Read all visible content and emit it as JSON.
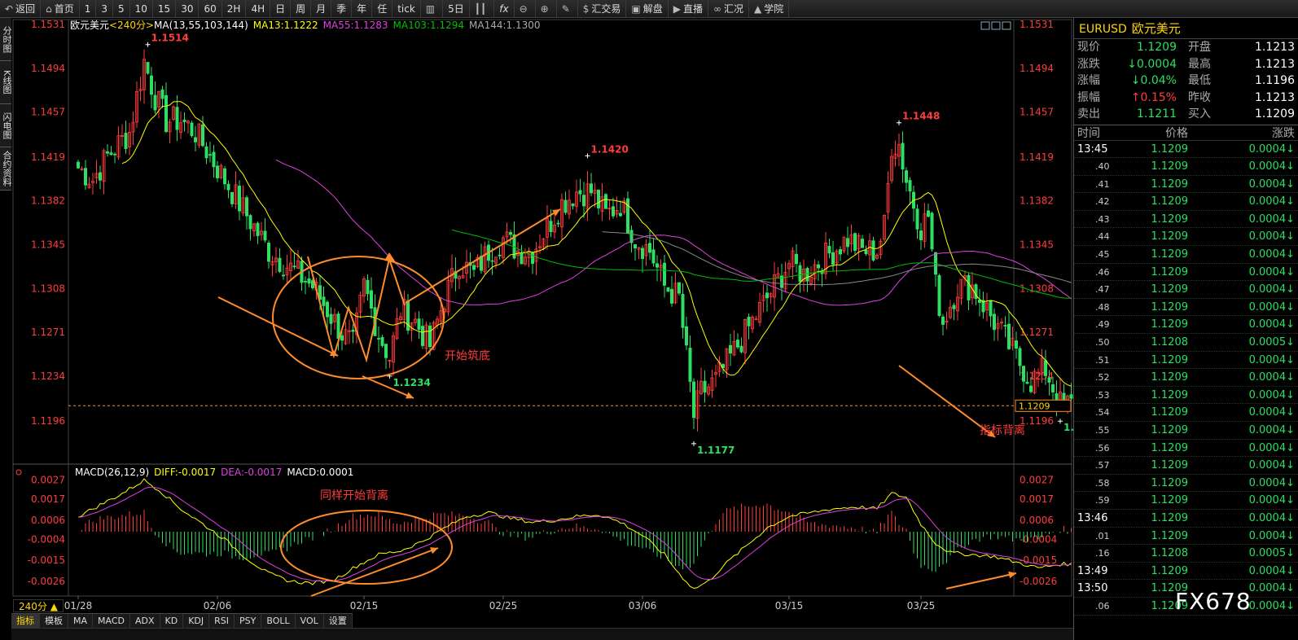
{
  "toolbar": {
    "items": [
      {
        "icon": "back-arrow-icon",
        "label": "返回"
      },
      {
        "icon": "home-icon",
        "label": "首页"
      },
      {
        "label": "1"
      },
      {
        "label": "3"
      },
      {
        "label": "5"
      },
      {
        "label": "10"
      },
      {
        "label": "15"
      },
      {
        "label": "30"
      },
      {
        "label": "60"
      },
      {
        "label": "2H"
      },
      {
        "label": "4H"
      },
      {
        "label": "日"
      },
      {
        "label": "周"
      },
      {
        "label": "月"
      },
      {
        "label": "季"
      },
      {
        "label": "年"
      },
      {
        "label": "任"
      },
      {
        "label": "tick"
      },
      {
        "icon": "draw-icon",
        "label": ""
      },
      {
        "label": "5日"
      },
      {
        "icon": "candle-icon",
        "label": ""
      },
      {
        "icon": "fx-icon",
        "label": "fx"
      },
      {
        "icon": "zoom-out-icon",
        "label": ""
      },
      {
        "icon": "zoom-in-icon",
        "label": ""
      },
      {
        "icon": "pen-icon",
        "label": ""
      },
      {
        "icon": "dollar-icon",
        "label": "汇交易"
      },
      {
        "icon": "chat-icon",
        "label": "解盘"
      },
      {
        "icon": "live-icon",
        "label": "直播"
      },
      {
        "icon": "link-icon",
        "label": "汇况"
      },
      {
        "icon": "school-icon",
        "label": "学院"
      }
    ]
  },
  "sidetabs": [
    "分时图",
    "K线图",
    "闪电图",
    "合约资料"
  ],
  "header": {
    "symbol": "欧元美元",
    "period": "<240分>",
    "ma": "MA(13,55,103,144)",
    "ma13": "MA13:1.1222",
    "ma55": "MA55:1.1283",
    "ma103": "MA103:1.1294",
    "ma144": "MA144:1.1300"
  },
  "macd_header": {
    "name": "MACD(26,12,9)",
    "diff": "DIFF:-0.0017",
    "dea": "DEA:-0.0017",
    "macd": "MACD:0.0001"
  },
  "period_button": "240分 ▲",
  "indicator_tabs": [
    "指标",
    "模板",
    "MA",
    "MACD",
    "ADX",
    "KD",
    "KDJ",
    "RSI",
    "PSY",
    "BOLL",
    "VOL",
    "设置"
  ],
  "watermark": "FX678",
  "colors": {
    "up": "#ff3c3c",
    "down": "#2ddf62",
    "ma13": "#ffff00",
    "ma55": "#e040e0",
    "ma103": "#00c000",
    "ma144": "#888888",
    "annotation": "#ff8c2a",
    "diff": "#ffff00",
    "dea": "#e040e0"
  },
  "chart_data": {
    "type": "candlestick",
    "price_axis": {
      "min": 1.117,
      "max": 1.1531,
      "ticks": [
        "1.1531",
        "1.1494",
        "1.1457",
        "1.1419",
        "1.1382",
        "1.1345",
        "1.1308",
        "1.1271",
        "1.1234",
        "1.1196"
      ]
    },
    "macd_axis": {
      "min": -0.0032,
      "max": 0.0029,
      "ticks": [
        "0.0027",
        "0.0017",
        "0.0006",
        "-0.0004",
        "-0.0015",
        "-0.0026"
      ]
    },
    "x_labels": [
      {
        "label": "01/28",
        "i": 0
      },
      {
        "label": "02/06",
        "i": 38
      },
      {
        "label": "02/15",
        "i": 78
      },
      {
        "label": "02/25",
        "i": 116
      },
      {
        "label": "03/06",
        "i": 154
      },
      {
        "label": "03/15",
        "i": 194
      },
      {
        "label": "03/25",
        "i": 230
      }
    ],
    "current_price": "1.1209",
    "price_labels": [
      {
        "text": "1.1514",
        "i": 19,
        "v": 1.1514,
        "kind": "high"
      },
      {
        "text": "1.1420",
        "i": 139,
        "v": 1.142,
        "kind": "high"
      },
      {
        "text": "1.1448",
        "i": 224,
        "v": 1.1448,
        "kind": "high"
      },
      {
        "text": "1.1234",
        "i": 85,
        "v": 1.1234,
        "kind": "low"
      },
      {
        "text": "1.1177",
        "i": 168,
        "v": 1.1177,
        "kind": "low"
      },
      {
        "text": "1.1196",
        "i": 268,
        "v": 1.1196,
        "kind": "low"
      }
    ],
    "anchors": [
      [
        0,
        1.141
      ],
      [
        4,
        1.14
      ],
      [
        8,
        1.142
      ],
      [
        14,
        1.144
      ],
      [
        18,
        1.15
      ],
      [
        21,
        1.147
      ],
      [
        24,
        1.145
      ],
      [
        28,
        1.145
      ],
      [
        32,
        1.144
      ],
      [
        36,
        1.142
      ],
      [
        40,
        1.14
      ],
      [
        44,
        1.138
      ],
      [
        48,
        1.136
      ],
      [
        52,
        1.134
      ],
      [
        56,
        1.133
      ],
      [
        60,
        1.132
      ],
      [
        64,
        1.131
      ],
      [
        68,
        1.129
      ],
      [
        72,
        1.127
      ],
      [
        75,
        1.126
      ],
      [
        78,
        1.131
      ],
      [
        82,
        1.127
      ],
      [
        85,
        1.125
      ],
      [
        88,
        1.129
      ],
      [
        92,
        1.128
      ],
      [
        96,
        1.126
      ],
      [
        100,
        1.13
      ],
      [
        104,
        1.133
      ],
      [
        108,
        1.132
      ],
      [
        112,
        1.134
      ],
      [
        116,
        1.135
      ],
      [
        120,
        1.134
      ],
      [
        124,
        1.134
      ],
      [
        128,
        1.136
      ],
      [
        132,
        1.138
      ],
      [
        136,
        1.139
      ],
      [
        140,
        1.139
      ],
      [
        144,
        1.137
      ],
      [
        148,
        1.138
      ],
      [
        152,
        1.135
      ],
      [
        156,
        1.134
      ],
      [
        160,
        1.131
      ],
      [
        164,
        1.13
      ],
      [
        166,
        1.125
      ],
      [
        168,
        1.12
      ],
      [
        170,
        1.122
      ],
      [
        174,
        1.123
      ],
      [
        178,
        1.125
      ],
      [
        182,
        1.127
      ],
      [
        186,
        1.129
      ],
      [
        190,
        1.131
      ],
      [
        194,
        1.133
      ],
      [
        198,
        1.132
      ],
      [
        202,
        1.133
      ],
      [
        206,
        1.134
      ],
      [
        210,
        1.135
      ],
      [
        214,
        1.134
      ],
      [
        218,
        1.134
      ],
      [
        220,
        1.136
      ],
      [
        222,
        1.143
      ],
      [
        224,
        1.143
      ],
      [
        226,
        1.14
      ],
      [
        230,
        1.136
      ],
      [
        232,
        1.137
      ],
      [
        234,
        1.131
      ],
      [
        236,
        1.128
      ],
      [
        240,
        1.131
      ],
      [
        244,
        1.131
      ],
      [
        248,
        1.129
      ],
      [
        252,
        1.127
      ],
      [
        256,
        1.125
      ],
      [
        260,
        1.123
      ],
      [
        264,
        1.124
      ],
      [
        268,
        1.121
      ],
      [
        271,
        1.121
      ]
    ],
    "macd_anchors": [
      [
        0,
        0.0008
      ],
      [
        6,
        0.0014
      ],
      [
        12,
        0.002
      ],
      [
        18,
        0.0027
      ],
      [
        22,
        0.0022
      ],
      [
        28,
        0.0012
      ],
      [
        34,
        0.0004
      ],
      [
        40,
        -0.0004
      ],
      [
        46,
        -0.0014
      ],
      [
        52,
        -0.0022
      ],
      [
        58,
        -0.0026
      ],
      [
        64,
        -0.0027
      ],
      [
        70,
        -0.0025
      ],
      [
        76,
        -0.0018
      ],
      [
        82,
        -0.0012
      ],
      [
        88,
        -0.001
      ],
      [
        94,
        -0.0005
      ],
      [
        100,
        0.0002
      ],
      [
        106,
        0.0008
      ],
      [
        112,
        0.001
      ],
      [
        118,
        0.0007
      ],
      [
        124,
        0.0005
      ],
      [
        130,
        0.0006
      ],
      [
        136,
        0.0008
      ],
      [
        142,
        0.0009
      ],
      [
        148,
        0.0005
      ],
      [
        154,
        -0.0002
      ],
      [
        160,
        -0.0012
      ],
      [
        164,
        -0.0022
      ],
      [
        168,
        -0.003
      ],
      [
        172,
        -0.0026
      ],
      [
        176,
        -0.0018
      ],
      [
        182,
        -0.0008
      ],
      [
        188,
        0.0002
      ],
      [
        194,
        0.0008
      ],
      [
        200,
        0.001
      ],
      [
        206,
        0.0012
      ],
      [
        212,
        0.0013
      ],
      [
        218,
        0.0012
      ],
      [
        222,
        0.002
      ],
      [
        226,
        0.0018
      ],
      [
        230,
        0.0004
      ],
      [
        234,
        -0.0006
      ],
      [
        238,
        -0.0011
      ],
      [
        244,
        -0.0012
      ],
      [
        250,
        -0.0013
      ],
      [
        256,
        -0.0016
      ],
      [
        262,
        -0.0019
      ],
      [
        268,
        -0.0017
      ],
      [
        271,
        -0.0017
      ]
    ],
    "annotations": [
      {
        "text": "开始筑底",
        "i": 100,
        "v": 1.1248
      },
      {
        "text": "指标背离",
        "i": 246,
        "v": 1.1185
      },
      {
        "text": "同样开始背离",
        "i": 66,
        "v": 0.0017,
        "pane": "macd"
      }
    ]
  },
  "quote": {
    "title_code": "EURUSD",
    "title_name": "欧元美元",
    "rows": [
      {
        "k": "现价",
        "v": "1.1209",
        "k2": "开盘",
        "v2": "1.1213",
        "vcls": "green"
      },
      {
        "k": "涨跌",
        "v": "↓0.0004",
        "k2": "最高",
        "v2": "1.1213",
        "vcls": "green"
      },
      {
        "k": "涨幅",
        "v": "↓0.04%",
        "k2": "最低",
        "v2": "1.1196",
        "vcls": "green"
      },
      {
        "k": "振幅",
        "v": "↑0.15%",
        "k2": "昨收",
        "v2": "1.1213",
        "vcls": "red"
      },
      {
        "k": "卖出",
        "v": "1.1211",
        "k2": "买入",
        "v2": "1.1209",
        "vcls": "green"
      }
    ],
    "tick_header": [
      "时间",
      "价格",
      "涨跌"
    ],
    "ticks": [
      {
        "t": "13:45",
        "p": "1.1209",
        "c": "0.0004↓",
        "big": true
      },
      {
        "t": ".40",
        "p": "1.1209",
        "c": "0.0004↓"
      },
      {
        "t": ".41",
        "p": "1.1209",
        "c": "0.0004↓"
      },
      {
        "t": ".42",
        "p": "1.1209",
        "c": "0.0004↓"
      },
      {
        "t": ".43",
        "p": "1.1209",
        "c": "0.0004↓"
      },
      {
        "t": ".44",
        "p": "1.1209",
        "c": "0.0004↓"
      },
      {
        "t": ".45",
        "p": "1.1209",
        "c": "0.0004↓"
      },
      {
        "t": ".46",
        "p": "1.1209",
        "c": "0.0004↓"
      },
      {
        "t": ".47",
        "p": "1.1209",
        "c": "0.0004↓"
      },
      {
        "t": ".48",
        "p": "1.1209",
        "c": "0.0004↓"
      },
      {
        "t": ".49",
        "p": "1.1209",
        "c": "0.0004↓"
      },
      {
        "t": ".50",
        "p": "1.1208",
        "c": "0.0005↓"
      },
      {
        "t": ".51",
        "p": "1.1209",
        "c": "0.0004↓"
      },
      {
        "t": ".52",
        "p": "1.1209",
        "c": "0.0004↓"
      },
      {
        "t": ".53",
        "p": "1.1209",
        "c": "0.0004↓"
      },
      {
        "t": ".54",
        "p": "1.1209",
        "c": "0.0004↓"
      },
      {
        "t": ".55",
        "p": "1.1209",
        "c": "0.0004↓"
      },
      {
        "t": ".56",
        "p": "1.1209",
        "c": "0.0004↓"
      },
      {
        "t": ".57",
        "p": "1.1209",
        "c": "0.0004↓"
      },
      {
        "t": ".58",
        "p": "1.1209",
        "c": "0.0004↓"
      },
      {
        "t": ".59",
        "p": "1.1209",
        "c": "0.0004↓"
      },
      {
        "t": "13:46",
        "p": "1.1209",
        "c": "0.0004↓",
        "big": true
      },
      {
        "t": ".01",
        "p": "1.1209",
        "c": "0.0004↓"
      },
      {
        "t": ".16",
        "p": "1.1208",
        "c": "0.0005↓"
      },
      {
        "t": "13:49",
        "p": "1.1209",
        "c": "0.0004↓",
        "big": true
      },
      {
        "t": "13:50",
        "p": "1.1209",
        "c": "0.0004↓",
        "big": true
      },
      {
        "t": ".06",
        "p": "1.1209",
        "c": "0.0004↓"
      }
    ]
  }
}
